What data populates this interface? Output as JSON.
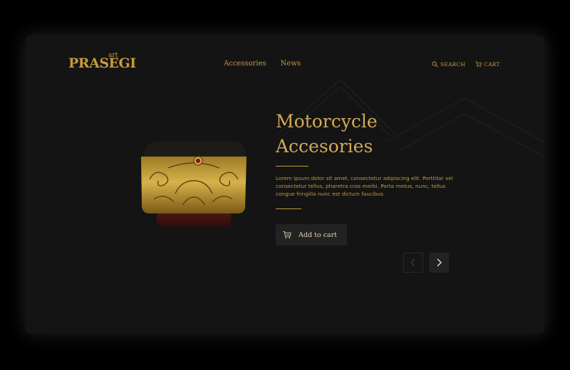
{
  "brand": {
    "name": "PRASEGI",
    "suffix": "art"
  },
  "nav": {
    "items": [
      {
        "label": "Accessories"
      },
      {
        "label": "News"
      }
    ]
  },
  "utility": {
    "search_label": "Search",
    "search_icon": "search-icon",
    "cart_label": "Cart",
    "cart_icon": "cart-icon"
  },
  "hero": {
    "title_line1": "Motorcycle",
    "title_line2": "Accesories",
    "description": "Lorem ipsum dolor sit amet, consectetur adipiscing elit. Porttitor vel consectetur tellus, pharetra cras morbi. Porta metus, nunc, tellus congue fringilla nunc est dictum faucibus.",
    "cta_label": "Add to cart",
    "cta_icon": "cart-icon"
  },
  "carousel": {
    "prev_icon": "chevron-left-icon",
    "next_icon": "chevron-right-icon"
  },
  "colors": {
    "page_background": "#000000",
    "card_background": "#141414",
    "accent_gold": "#c79a3a",
    "heading_gold": "#d3a957",
    "button_background": "#222222"
  }
}
